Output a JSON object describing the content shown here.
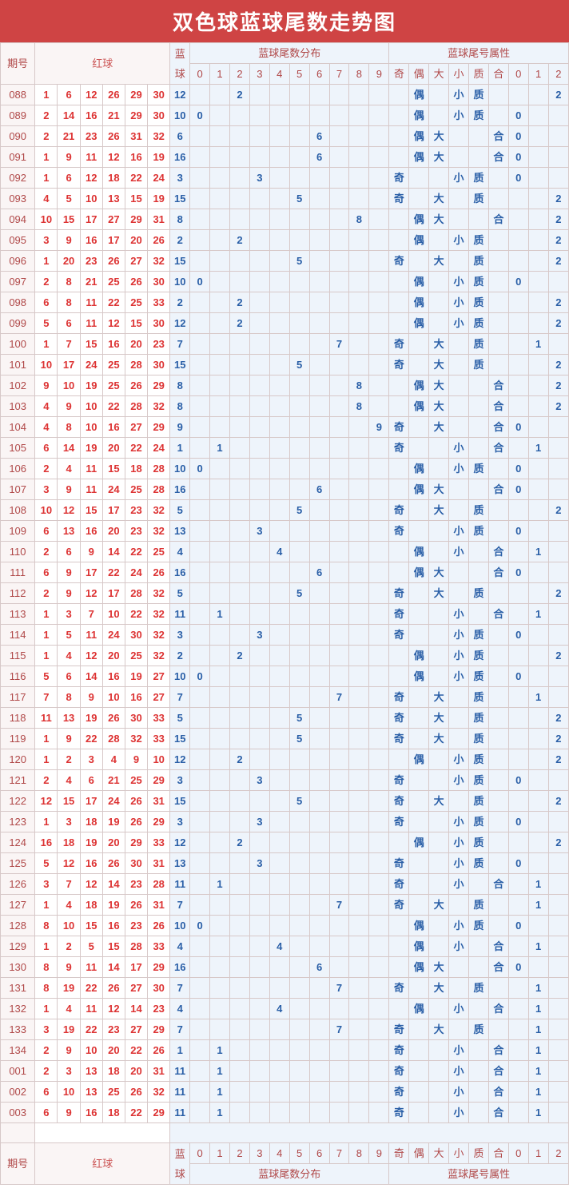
{
  "title": "双色球蓝球尾数走势图",
  "headers": {
    "period": "期号",
    "red": "红球",
    "blue": "蓝球",
    "tail": "蓝球尾数分布",
    "attr": "蓝球尾号属性",
    "tailCols": [
      "0",
      "1",
      "2",
      "3",
      "4",
      "5",
      "6",
      "7",
      "8",
      "9"
    ],
    "attrCols": [
      "奇",
      "偶",
      "大",
      "小",
      "质",
      "合",
      "0",
      "1",
      "2"
    ]
  },
  "chart_data": {
    "type": "table",
    "title": "双色球蓝球尾数走势图",
    "columns": [
      "期号",
      "红球1",
      "红球2",
      "红球3",
      "红球4",
      "红球5",
      "红球6",
      "蓝球",
      "尾0",
      "尾1",
      "尾2",
      "尾3",
      "尾4",
      "尾5",
      "尾6",
      "尾7",
      "尾8",
      "尾9",
      "奇",
      "偶",
      "大",
      "小",
      "质",
      "合",
      "0",
      "1",
      "2"
    ],
    "rows": [
      [
        "088",
        1,
        6,
        12,
        26,
        29,
        30,
        12,
        "",
        "",
        "2",
        "",
        "",
        "",
        "",
        "",
        "",
        "",
        "",
        "偶",
        "",
        "小",
        "质",
        "",
        "",
        "",
        "2"
      ],
      [
        "089",
        2,
        14,
        16,
        21,
        29,
        30,
        10,
        "0",
        "",
        "",
        "",
        "",
        "",
        "",
        "",
        "",
        "",
        "",
        "偶",
        "",
        "小",
        "质",
        "",
        "0",
        "",
        ""
      ],
      [
        "090",
        2,
        21,
        23,
        26,
        31,
        32,
        6,
        "",
        "",
        "",
        "",
        "",
        "",
        "6",
        "",
        "",
        "",
        "",
        "偶",
        "大",
        "",
        "",
        "合",
        "0",
        "",
        ""
      ],
      [
        "091",
        1,
        9,
        11,
        12,
        16,
        19,
        16,
        "",
        "",
        "",
        "",
        "",
        "",
        "6",
        "",
        "",
        "",
        "",
        "偶",
        "大",
        "",
        "",
        "合",
        "0",
        "",
        ""
      ],
      [
        "092",
        1,
        6,
        12,
        18,
        22,
        24,
        3,
        "",
        "",
        "",
        "3",
        "",
        "",
        "",
        "",
        "",
        "",
        "奇",
        "",
        "",
        "小",
        "质",
        "",
        "0",
        "",
        ""
      ],
      [
        "093",
        4,
        5,
        10,
        13,
        15,
        19,
        15,
        "",
        "",
        "",
        "",
        "",
        "5",
        "",
        "",
        "",
        "",
        "奇",
        "",
        "大",
        "",
        "质",
        "",
        "",
        "",
        "2"
      ],
      [
        "094",
        10,
        15,
        17,
        27,
        29,
        31,
        8,
        "",
        "",
        "",
        "",
        "",
        "",
        "",
        "",
        "8",
        "",
        "",
        "偶",
        "大",
        "",
        "",
        "合",
        "",
        "",
        "2"
      ],
      [
        "095",
        3,
        9,
        16,
        17,
        20,
        26,
        2,
        "",
        "",
        "2",
        "",
        "",
        "",
        "",
        "",
        "",
        "",
        "",
        "偶",
        "",
        "小",
        "质",
        "",
        "",
        "",
        "2"
      ],
      [
        "096",
        1,
        20,
        23,
        26,
        27,
        32,
        15,
        "",
        "",
        "",
        "",
        "",
        "5",
        "",
        "",
        "",
        "",
        "奇",
        "",
        "大",
        "",
        "质",
        "",
        "",
        "",
        "2"
      ],
      [
        "097",
        2,
        8,
        21,
        25,
        26,
        30,
        10,
        "0",
        "",
        "",
        "",
        "",
        "",
        "",
        "",
        "",
        "",
        "",
        "偶",
        "",
        "小",
        "质",
        "",
        "0",
        "",
        ""
      ],
      [
        "098",
        6,
        8,
        11,
        22,
        25,
        33,
        2,
        "",
        "",
        "2",
        "",
        "",
        "",
        "",
        "",
        "",
        "",
        "",
        "偶",
        "",
        "小",
        "质",
        "",
        "",
        "",
        "2"
      ],
      [
        "099",
        5,
        6,
        11,
        12,
        15,
        30,
        12,
        "",
        "",
        "2",
        "",
        "",
        "",
        "",
        "",
        "",
        "",
        "",
        "偶",
        "",
        "小",
        "质",
        "",
        "",
        "",
        "2"
      ],
      [
        "100",
        1,
        7,
        15,
        16,
        20,
        23,
        7,
        "",
        "",
        "",
        "",
        "",
        "",
        "",
        "7",
        "",
        "",
        "奇",
        "",
        "大",
        "",
        "质",
        "",
        "",
        "1",
        ""
      ],
      [
        "101",
        10,
        17,
        24,
        25,
        28,
        30,
        15,
        "",
        "",
        "",
        "",
        "",
        "5",
        "",
        "",
        "",
        "",
        "奇",
        "",
        "大",
        "",
        "质",
        "",
        "",
        "",
        "2"
      ],
      [
        "102",
        9,
        10,
        19,
        25,
        26,
        29,
        8,
        "",
        "",
        "",
        "",
        "",
        "",
        "",
        "",
        "8",
        "",
        "",
        "偶",
        "大",
        "",
        "",
        "合",
        "",
        "",
        "2"
      ],
      [
        "103",
        4,
        9,
        10,
        22,
        28,
        32,
        8,
        "",
        "",
        "",
        "",
        "",
        "",
        "",
        "",
        "8",
        "",
        "",
        "偶",
        "大",
        "",
        "",
        "合",
        "",
        "",
        "2"
      ],
      [
        "104",
        4,
        8,
        10,
        16,
        27,
        29,
        9,
        "",
        "",
        "",
        "",
        "",
        "",
        "",
        "",
        "",
        "9",
        "奇",
        "",
        "大",
        "",
        "",
        "合",
        "0",
        "",
        ""
      ],
      [
        "105",
        6,
        14,
        19,
        20,
        22,
        24,
        1,
        "",
        "1",
        "",
        "",
        "",
        "",
        "",
        "",
        "",
        "",
        "奇",
        "",
        "",
        "小",
        "",
        "合",
        "",
        "1",
        ""
      ],
      [
        "106",
        2,
        4,
        11,
        15,
        18,
        28,
        10,
        "0",
        "",
        "",
        "",
        "",
        "",
        "",
        "",
        "",
        "",
        "",
        "偶",
        "",
        "小",
        "质",
        "",
        "0",
        "",
        ""
      ],
      [
        "107",
        3,
        9,
        11,
        24,
        25,
        28,
        16,
        "",
        "",
        "",
        "",
        "",
        "",
        "6",
        "",
        "",
        "",
        "",
        "偶",
        "大",
        "",
        "",
        "合",
        "0",
        "",
        ""
      ],
      [
        "108",
        10,
        12,
        15,
        17,
        23,
        32,
        5,
        "",
        "",
        "",
        "",
        "",
        "5",
        "",
        "",
        "",
        "",
        "奇",
        "",
        "大",
        "",
        "质",
        "",
        "",
        "",
        "2"
      ],
      [
        "109",
        6,
        13,
        16,
        20,
        23,
        32,
        13,
        "",
        "",
        "",
        "3",
        "",
        "",
        "",
        "",
        "",
        "",
        "奇",
        "",
        "",
        "小",
        "质",
        "",
        "0",
        "",
        ""
      ],
      [
        "110",
        2,
        6,
        9,
        14,
        22,
        25,
        4,
        "",
        "",
        "",
        "",
        "4",
        "",
        "",
        "",
        "",
        "",
        "",
        "偶",
        "",
        "小",
        "",
        "合",
        "",
        "1",
        ""
      ],
      [
        "111",
        6,
        9,
        17,
        22,
        24,
        26,
        16,
        "",
        "",
        "",
        "",
        "",
        "",
        "6",
        "",
        "",
        "",
        "",
        "偶",
        "大",
        "",
        "",
        "合",
        "0",
        "",
        ""
      ],
      [
        "112",
        2,
        9,
        12,
        17,
        28,
        32,
        5,
        "",
        "",
        "",
        "",
        "",
        "5",
        "",
        "",
        "",
        "",
        "奇",
        "",
        "大",
        "",
        "质",
        "",
        "",
        "",
        "2"
      ],
      [
        "113",
        1,
        3,
        7,
        10,
        22,
        32,
        11,
        "",
        "1",
        "",
        "",
        "",
        "",
        "",
        "",
        "",
        "",
        "奇",
        "",
        "",
        "小",
        "",
        "合",
        "",
        "1",
        ""
      ],
      [
        "114",
        1,
        5,
        11,
        24,
        30,
        32,
        3,
        "",
        "",
        "",
        "3",
        "",
        "",
        "",
        "",
        "",
        "",
        "奇",
        "",
        "",
        "小",
        "质",
        "",
        "0",
        "",
        ""
      ],
      [
        "115",
        1,
        4,
        12,
        20,
        25,
        32,
        2,
        "",
        "",
        "2",
        "",
        "",
        "",
        "",
        "",
        "",
        "",
        "",
        "偶",
        "",
        "小",
        "质",
        "",
        "",
        "",
        "2"
      ],
      [
        "116",
        5,
        6,
        14,
        16,
        19,
        27,
        10,
        "0",
        "",
        "",
        "",
        "",
        "",
        "",
        "",
        "",
        "",
        "",
        "偶",
        "",
        "小",
        "质",
        "",
        "0",
        "",
        ""
      ],
      [
        "117",
        7,
        8,
        9,
        10,
        16,
        27,
        7,
        "",
        "",
        "",
        "",
        "",
        "",
        "",
        "7",
        "",
        "",
        "奇",
        "",
        "大",
        "",
        "质",
        "",
        "",
        "1",
        ""
      ],
      [
        "118",
        11,
        13,
        19,
        26,
        30,
        33,
        5,
        "",
        "",
        "",
        "",
        "",
        "5",
        "",
        "",
        "",
        "",
        "奇",
        "",
        "大",
        "",
        "质",
        "",
        "",
        "",
        "2"
      ],
      [
        "119",
        1,
        9,
        22,
        28,
        32,
        33,
        15,
        "",
        "",
        "",
        "",
        "",
        "5",
        "",
        "",
        "",
        "",
        "奇",
        "",
        "大",
        "",
        "质",
        "",
        "",
        "",
        "2"
      ],
      [
        "120",
        1,
        2,
        3,
        4,
        9,
        10,
        12,
        "",
        "",
        "2",
        "",
        "",
        "",
        "",
        "",
        "",
        "",
        "",
        "偶",
        "",
        "小",
        "质",
        "",
        "",
        "",
        "2"
      ],
      [
        "121",
        2,
        4,
        6,
        21,
        25,
        29,
        3,
        "",
        "",
        "",
        "3",
        "",
        "",
        "",
        "",
        "",
        "",
        "奇",
        "",
        "",
        "小",
        "质",
        "",
        "0",
        "",
        ""
      ],
      [
        "122",
        12,
        15,
        17,
        24,
        26,
        31,
        15,
        "",
        "",
        "",
        "",
        "",
        "5",
        "",
        "",
        "",
        "",
        "奇",
        "",
        "大",
        "",
        "质",
        "",
        "",
        "",
        "2"
      ],
      [
        "123",
        1,
        3,
        18,
        19,
        26,
        29,
        3,
        "",
        "",
        "",
        "3",
        "",
        "",
        "",
        "",
        "",
        "",
        "奇",
        "",
        "",
        "小",
        "质",
        "",
        "0",
        "",
        ""
      ],
      [
        "124",
        16,
        18,
        19,
        20,
        29,
        33,
        12,
        "",
        "",
        "2",
        "",
        "",
        "",
        "",
        "",
        "",
        "",
        "",
        "偶",
        "",
        "小",
        "质",
        "",
        "",
        "",
        "2"
      ],
      [
        "125",
        5,
        12,
        16,
        26,
        30,
        31,
        13,
        "",
        "",
        "",
        "3",
        "",
        "",
        "",
        "",
        "",
        "",
        "奇",
        "",
        "",
        "小",
        "质",
        "",
        "0",
        "",
        ""
      ],
      [
        "126",
        3,
        7,
        12,
        14,
        23,
        28,
        11,
        "",
        "1",
        "",
        "",
        "",
        "",
        "",
        "",
        "",
        "",
        "奇",
        "",
        "",
        "小",
        "",
        "合",
        "",
        "1",
        ""
      ],
      [
        "127",
        1,
        4,
        18,
        19,
        26,
        31,
        7,
        "",
        "",
        "",
        "",
        "",
        "",
        "",
        "7",
        "",
        "",
        "奇",
        "",
        "大",
        "",
        "质",
        "",
        "",
        "1",
        ""
      ],
      [
        "128",
        8,
        10,
        15,
        16,
        23,
        26,
        10,
        "0",
        "",
        "",
        "",
        "",
        "",
        "",
        "",
        "",
        "",
        "",
        "偶",
        "",
        "小",
        "质",
        "",
        "0",
        "",
        ""
      ],
      [
        "129",
        1,
        2,
        5,
        15,
        28,
        33,
        4,
        "",
        "",
        "",
        "",
        "4",
        "",
        "",
        "",
        "",
        "",
        "",
        "偶",
        "",
        "小",
        "",
        "合",
        "",
        "1",
        ""
      ],
      [
        "130",
        8,
        9,
        11,
        14,
        17,
        29,
        16,
        "",
        "",
        "",
        "",
        "",
        "",
        "6",
        "",
        "",
        "",
        "",
        "偶",
        "大",
        "",
        "",
        "合",
        "0",
        "",
        ""
      ],
      [
        "131",
        8,
        19,
        22,
        26,
        27,
        30,
        7,
        "",
        "",
        "",
        "",
        "",
        "",
        "",
        "7",
        "",
        "",
        "奇",
        "",
        "大",
        "",
        "质",
        "",
        "",
        "1",
        ""
      ],
      [
        "132",
        1,
        4,
        11,
        12,
        14,
        23,
        4,
        "",
        "",
        "",
        "",
        "4",
        "",
        "",
        "",
        "",
        "",
        "",
        "偶",
        "",
        "小",
        "",
        "合",
        "",
        "1",
        ""
      ],
      [
        "133",
        3,
        19,
        22,
        23,
        27,
        29,
        7,
        "",
        "",
        "",
        "",
        "",
        "",
        "",
        "7",
        "",
        "",
        "奇",
        "",
        "大",
        "",
        "质",
        "",
        "",
        "1",
        ""
      ],
      [
        "134",
        2,
        9,
        10,
        20,
        22,
        26,
        1,
        "",
        "1",
        "",
        "",
        "",
        "",
        "",
        "",
        "",
        "",
        "奇",
        "",
        "",
        "小",
        "",
        "合",
        "",
        "1",
        ""
      ],
      [
        "001",
        2,
        3,
        13,
        18,
        20,
        31,
        11,
        "",
        "1",
        "",
        "",
        "",
        "",
        "",
        "",
        "",
        "",
        "奇",
        "",
        "",
        "小",
        "",
        "合",
        "",
        "1",
        ""
      ],
      [
        "002",
        6,
        10,
        13,
        25,
        26,
        32,
        11,
        "",
        "1",
        "",
        "",
        "",
        "",
        "",
        "",
        "",
        "",
        "奇",
        "",
        "",
        "小",
        "",
        "合",
        "",
        "1",
        ""
      ],
      [
        "003",
        6,
        9,
        16,
        18,
        22,
        29,
        11,
        "",
        "1",
        "",
        "",
        "",
        "",
        "",
        "",
        "",
        "",
        "奇",
        "",
        "",
        "小",
        "",
        "合",
        "",
        "1",
        ""
      ]
    ]
  }
}
